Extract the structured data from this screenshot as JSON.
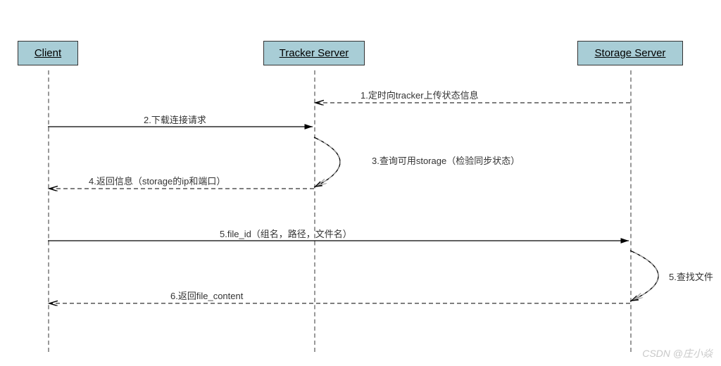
{
  "participants": {
    "client": "Client",
    "tracker": "Tracker Server",
    "storage": "Storage Server"
  },
  "messages": {
    "m1": "1.定时向tracker上传状态信息",
    "m2": "2.下载连接请求",
    "m3": "3.查询可用storage（检验同步状态）",
    "m4": "4.返回信息（storage的ip和端口）",
    "m5": "5.file_id（组名，路径，文件名）",
    "m5b": "5.查找文件",
    "m6": "6.返回file_content"
  },
  "watermark": "CSDN @庄小焱"
}
